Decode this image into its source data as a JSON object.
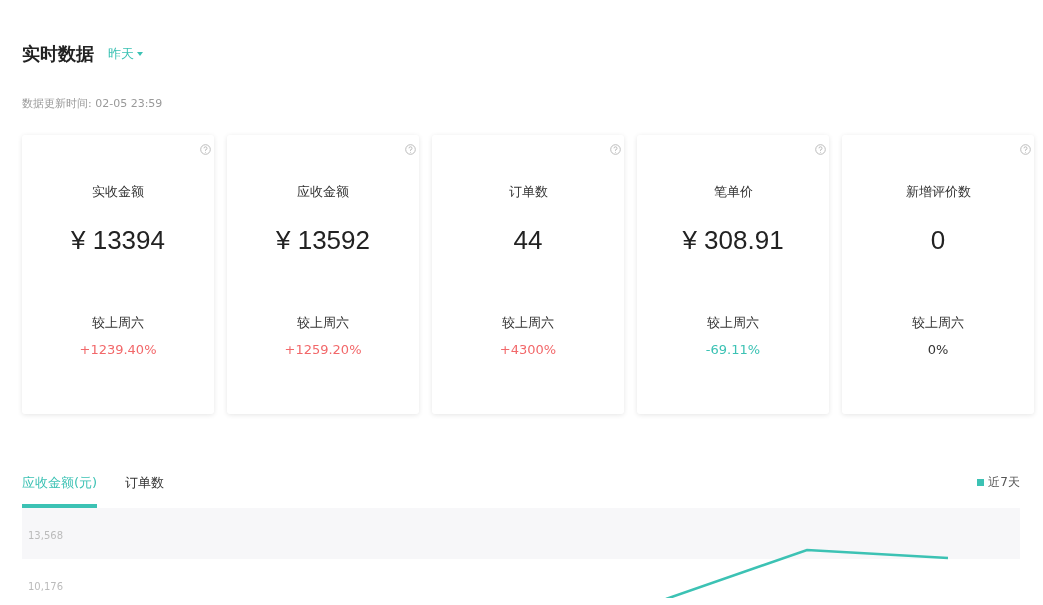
{
  "header": {
    "title": "实时数据",
    "date_filter": "昨天"
  },
  "update_time": "数据更新时间: 02-05 23:59",
  "metrics": [
    {
      "label": "实收金额",
      "value": "¥ 13394",
      "compare_label": "较上周六",
      "change": "+1239.40%",
      "color": "#f2686a"
    },
    {
      "label": "应收金额",
      "value": "¥ 13592",
      "compare_label": "较上周六",
      "change": "+1259.20%",
      "color": "#f2686a"
    },
    {
      "label": "订单数",
      "value": "44",
      "compare_label": "较上周六",
      "change": "+4300%",
      "color": "#f2686a"
    },
    {
      "label": "笔单价",
      "value": "¥ 308.91",
      "compare_label": "较上周六",
      "change": "-69.11%",
      "color": "#3cc2b4"
    },
    {
      "label": "新增评价数",
      "value": "0",
      "compare_label": "较上周六",
      "change": "0%",
      "color": "#333333"
    }
  ],
  "tabs": [
    {
      "label": "应收金额(元)",
      "selected": true
    },
    {
      "label": "订单数",
      "selected": false
    }
  ],
  "chart": {
    "legend": "近7天",
    "y_axis_labels": [
      "13,568",
      "10,176"
    ]
  }
}
